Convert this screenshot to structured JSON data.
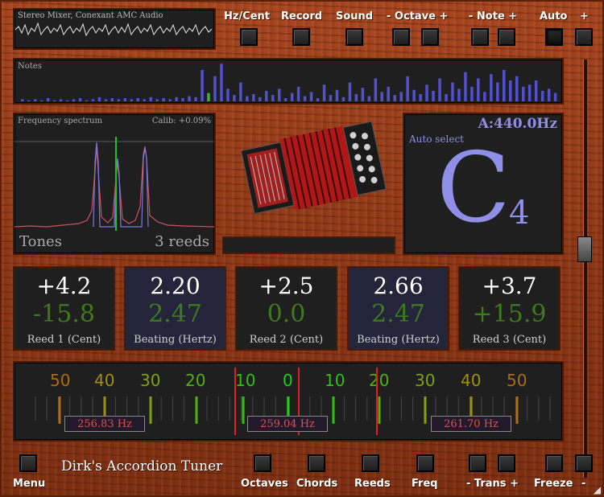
{
  "app_title": "Dirk's Accordion Tuner",
  "waveform_label": "Stereo Mixer, Conexant AMC Audio",
  "notes_label": "Notes",
  "top_buttons": {
    "hz_cent": "Hz/Cent",
    "record": "Record",
    "sound": "Sound",
    "octave": "- Octave +",
    "note": "- Note +",
    "auto": "Auto",
    "plus": "+"
  },
  "spectrum": {
    "title": "Frequency spectrum",
    "calib": "Calib: +0.09%",
    "tones": "Tones",
    "reeds": "3 reeds"
  },
  "note_display": {
    "ref": "A:440.0Hz",
    "mode": "Auto select",
    "note": "C",
    "octave": "4"
  },
  "reeds": [
    {
      "top": "+4.2",
      "mid": "-15.8",
      "caption": "Reed 1 (Cent)"
    },
    {
      "top": "2.20",
      "mid": "2.47",
      "caption": "Beating (Hertz)"
    },
    {
      "top": "+2.5",
      "mid": "0.0",
      "caption": "Reed 2 (Cent)"
    },
    {
      "top": "2.66",
      "mid": "2.47",
      "caption": "Beating (Hertz)"
    },
    {
      "top": "+3.7",
      "mid": "+15.9",
      "caption": "Reed 3 (Cent)"
    }
  ],
  "scale": {
    "labels": [
      "50",
      "40",
      "30",
      "20",
      "10",
      "0",
      "10",
      "20",
      "30",
      "40",
      "50"
    ],
    "freqs": [
      "256.83 Hz",
      "259.04 Hz",
      "261.70 Hz"
    ]
  },
  "bottom_buttons": {
    "menu": "Menu",
    "octaves": "Octaves",
    "chords": "Chords",
    "reeds": "Reeds",
    "freq": "Freq",
    "trans": "- Trans +",
    "freeze": "Freeze",
    "minus": "-"
  },
  "colors": {
    "wood": "#9a3f1a",
    "panel": "#1f1f1f",
    "note_color": "#8f8fe8",
    "green": "#3f7a1f",
    "red_line": "#e02020",
    "freq_text": "#e05050",
    "bar_blue": "#5050d0"
  }
}
